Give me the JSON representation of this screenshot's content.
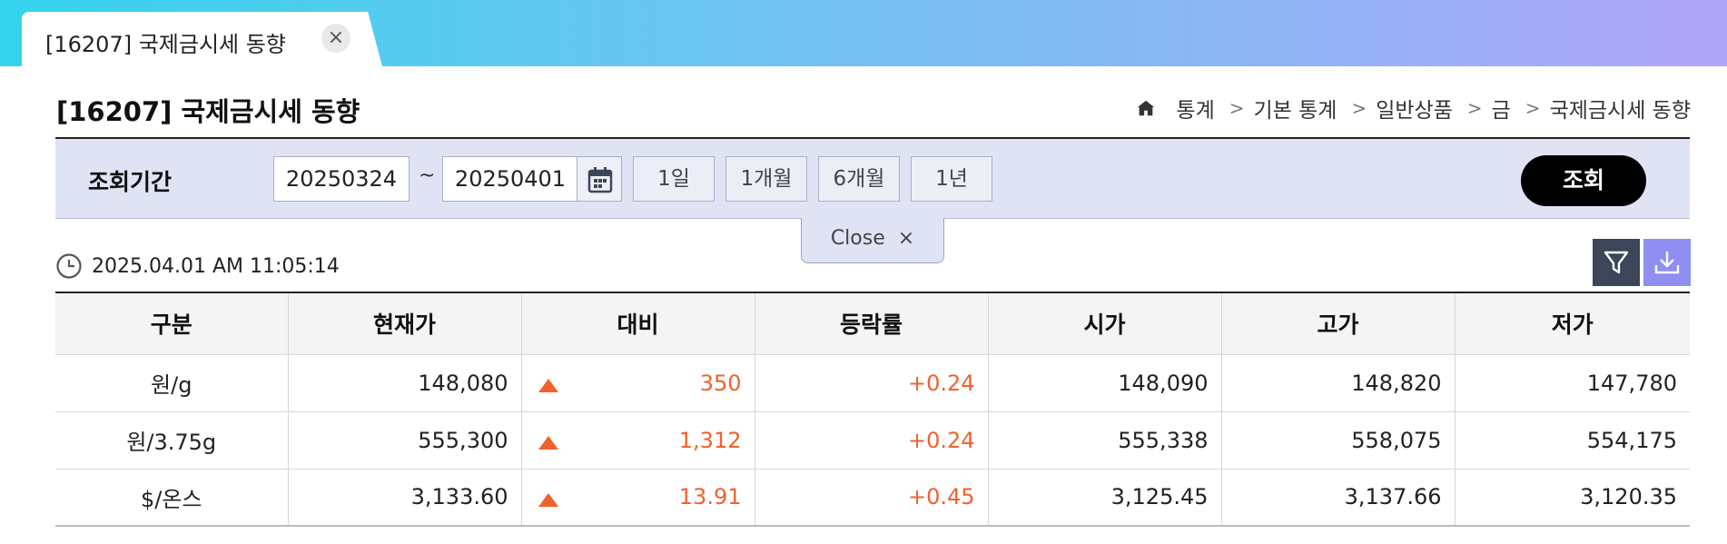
{
  "tab": {
    "title": "[16207] 국제금시세 동향",
    "close_label": "×"
  },
  "page_title": "[16207] 국제금시세 동향",
  "breadcrumb": {
    "separator": ">",
    "items": [
      "통계",
      "기본 통계",
      "일반상품",
      "금",
      "국제금시세 동향"
    ]
  },
  "search": {
    "label": "조회기간",
    "start_date": "20250324",
    "tilde": "~",
    "end_date": "20250401",
    "periods": [
      "1일",
      "1개월",
      "6개월",
      "1년"
    ],
    "query_label": "조회"
  },
  "close_panel": {
    "label": "Close",
    "x": "×"
  },
  "timestamp": "2025.04.01 AM 11:05:14",
  "table": {
    "headers": [
      "구분",
      "현재가",
      "대비",
      "등락률",
      "시가",
      "고가",
      "저가"
    ],
    "rows": [
      {
        "unit": "원/g",
        "current": "148,080",
        "change": "350",
        "rate": "+0.24",
        "open": "148,090",
        "high": "148,820",
        "low": "147,780"
      },
      {
        "unit": "원/3.75g",
        "current": "555,300",
        "change": "1,312",
        "rate": "+0.24",
        "open": "555,338",
        "high": "558,075",
        "low": "554,175"
      },
      {
        "unit": "$/온스",
        "current": "3,133.60",
        "change": "13.91",
        "rate": "+0.45",
        "open": "3,125.45",
        "high": "3,137.66",
        "low": "3,120.35"
      }
    ]
  },
  "colors": {
    "up": "#f0622d",
    "search_bg": "#dfe3f4",
    "query_btn": "#000000",
    "download_btn": "#8f8ff2",
    "filter_btn": "#3c4658"
  },
  "icons": {
    "home": "home-icon",
    "calendar": "calendar-icon",
    "clock": "clock-icon",
    "filter": "filter-icon",
    "download": "download-icon",
    "up": "triangle-up-icon"
  }
}
